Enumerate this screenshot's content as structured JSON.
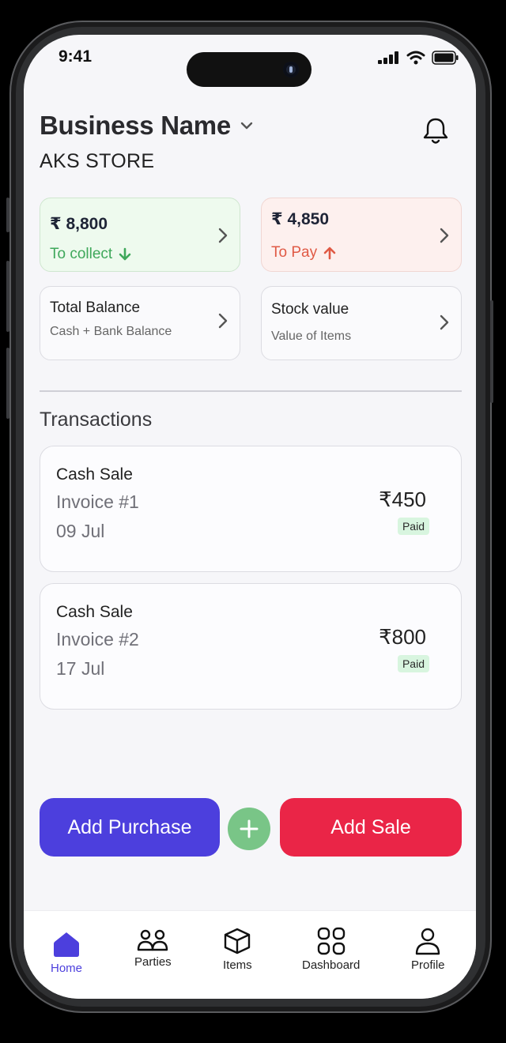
{
  "status_bar": {
    "time": "9:41"
  },
  "header": {
    "business_name": "Business Name",
    "store_name": "AKS STORE"
  },
  "summary": {
    "collect": {
      "amount": "₹ 8,800",
      "label": "To collect"
    },
    "pay": {
      "amount": "₹ 4,850",
      "label": "To Pay"
    },
    "balance": {
      "title": "Total Balance",
      "desc": "Cash + Bank Balance"
    },
    "stock": {
      "title": "Stock value",
      "desc": "Value of Items"
    }
  },
  "transactions": {
    "title": "Transactions",
    "items": [
      {
        "type": "Cash Sale",
        "invoice": "Invoice #1",
        "date": "09 Jul",
        "amount": "₹450",
        "status": "Paid"
      },
      {
        "type": "Cash Sale",
        "invoice": "Invoice #2",
        "date": "17 Jul",
        "amount": "₹800",
        "status": "Paid"
      }
    ]
  },
  "actions": {
    "add_purchase": "Add Purchase",
    "add_sale": "Add Sale"
  },
  "nav": {
    "items": [
      {
        "label": "Home",
        "icon": "home-icon",
        "active": true
      },
      {
        "label": "Parties",
        "icon": "people-icon"
      },
      {
        "label": "Items",
        "icon": "box-icon"
      },
      {
        "label": "Dashboard",
        "icon": "grid-icon"
      },
      {
        "label": "Profile",
        "icon": "user-icon"
      }
    ]
  },
  "colors": {
    "accent": "#4c3fdd",
    "sale": "#ea2547",
    "collect": "#3fa85b",
    "pay": "#e05a45",
    "plus": "#79c587"
  }
}
